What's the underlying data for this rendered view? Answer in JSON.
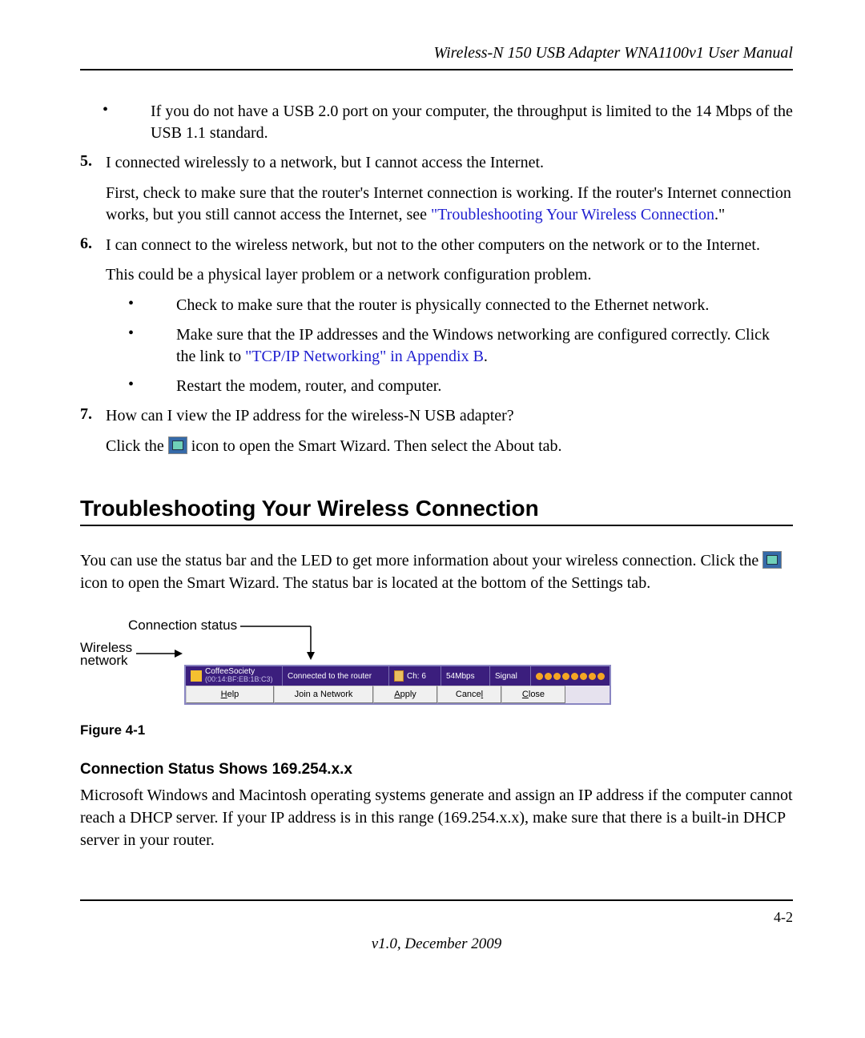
{
  "header": "Wireless-N 150 USB Adapter WNA1100v1 User Manual",
  "top_bullet": "If you do not have a USB 2.0 port on your computer, the throughput is limited to the 14 Mbps of the USB 1.1 standard.",
  "item5": {
    "num": "5.",
    "q": "I connected wirelessly to a network, but I cannot access the Internet.",
    "a_pre": "First, check to make sure that the router's Internet connection is working. If the router's Internet connection works, but you still cannot access the Internet, see ",
    "a_link": "\"Troubleshooting Your Wireless Connection",
    "a_post": ".\""
  },
  "item6": {
    "num": "6.",
    "q": "I can connect to the wireless network, but not to the other computers on the network or to the Internet.",
    "a": "This could be a physical layer problem or a network configuration problem.",
    "b1": "Check to make sure that the router is physically connected to the Ethernet network.",
    "b2_pre": "Make sure that the IP addresses and the Windows networking are configured correctly. Click the link to ",
    "b2_link": "\"TCP/IP Networking\" in Appendix B",
    "b2_post": ".",
    "b3": "Restart the modem, router, and computer."
  },
  "item7": {
    "num": "7.",
    "q": "How can I view the IP address for the wireless-N USB adapter?",
    "a_pre": "Click the ",
    "a_post": " icon to open the Smart Wizard. Then select the About tab."
  },
  "section_title": "Troubleshooting Your Wireless Connection",
  "section_para_pre": "You can use the status bar and the LED to get more information about your wireless connection. Click the ",
  "section_para_post": " icon to open the Smart Wizard. The status bar is located at the bottom of the Settings tab.",
  "callout1": "Connection status",
  "callout2_l1": "Wireless",
  "callout2_l2": "network",
  "statusbar": {
    "ssid": "CoffeeSociety",
    "mac": "(00:14:BF:EB:1B:C3)",
    "connected": "Connected to the router",
    "ch_label": "Ch:",
    "ch_value": "6",
    "rate": "54Mbps",
    "signal_label": "Signal",
    "btn_help": "Help",
    "btn_join": "Join a Network",
    "btn_apply": "Apply",
    "btn_cancel": "Cancel",
    "btn_close": "Close"
  },
  "figure_caption": "Figure 4-1",
  "subhead": "Connection Status Shows 169.254.x.x",
  "sub_para": "Microsoft Windows and Macintosh operating systems generate and assign an IP address if the computer cannot reach a DHCP server. If your IP address is in this range (169.254.x.x), make sure that there is a built-in DHCP server in your router.",
  "page_number": "4-2",
  "version": "v1.0, December 2009"
}
